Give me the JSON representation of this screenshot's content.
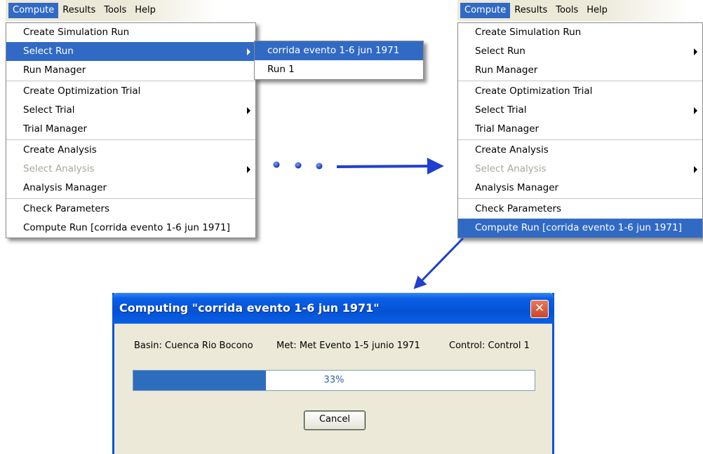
{
  "menubar": {
    "items": [
      "Compute",
      "Results",
      "Tools",
      "Help"
    ]
  },
  "compute_menu": {
    "items": [
      {
        "label": "Create Simulation Run"
      },
      {
        "label": "Select Run"
      },
      {
        "label": "Run Manager"
      },
      {
        "label": "Create Optimization Trial"
      },
      {
        "label": "Select Trial"
      },
      {
        "label": "Trial Manager"
      },
      {
        "label": "Create Analysis"
      },
      {
        "label": "Select Analysis"
      },
      {
        "label": "Analysis Manager"
      },
      {
        "label": "Check Parameters"
      },
      {
        "label": "Compute Run [corrida evento 1-6 jun 1971]"
      }
    ]
  },
  "select_run_submenu": {
    "items": [
      "corrida evento 1-6 jun 1971",
      "Run 1"
    ]
  },
  "dialog": {
    "title": "Computing \"corrida evento 1-6 jun 1971\"",
    "close_symbol": "✕",
    "basin": "Basin: Cuenca Rio Bocono",
    "met": "Met: Met Evento 1-5 junio 1971",
    "control": "Control: Control 1",
    "progress_fraction": 0.33,
    "progress_text": "33%",
    "cancel_label": "Cancel"
  },
  "annotation": {
    "ellipsis_dots": 3,
    "arrow_color": "#1f3fd0"
  },
  "colors": {
    "menu_highlight": "#316ac5",
    "titlebar": "#0452d4",
    "dialog_bg": "#ece9d8"
  }
}
